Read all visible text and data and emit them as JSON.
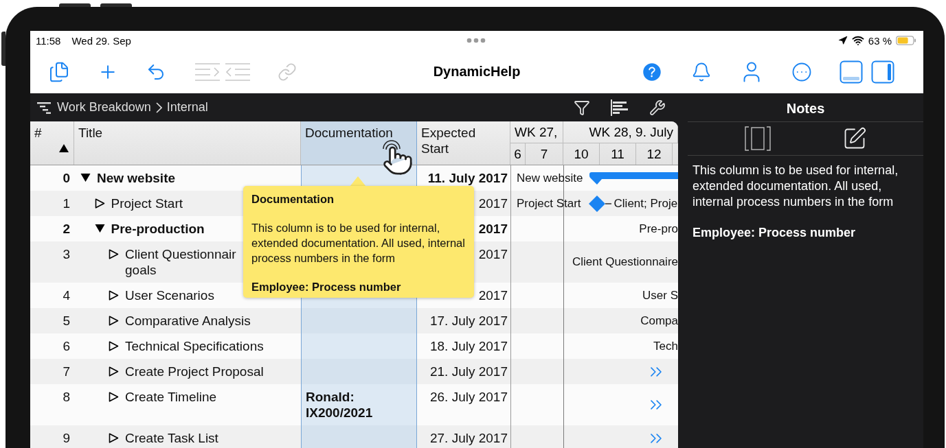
{
  "status_bar": {
    "time": "11:58",
    "date": "Wed 29. Sep",
    "battery": "63 %"
  },
  "toolbar": {
    "left_tools": [
      {
        "kind": "documents",
        "disabled": false
      },
      {
        "kind": "add",
        "disabled": false
      },
      {
        "kind": "undo",
        "disabled": false
      },
      {
        "kind": "indent",
        "disabled": true
      },
      {
        "kind": "outdent",
        "disabled": true
      },
      {
        "kind": "link",
        "disabled": true
      }
    ],
    "title": "DynamicHelp",
    "right_tools": [
      {
        "kind": "help"
      },
      {
        "kind": "notifications"
      },
      {
        "kind": "profile"
      },
      {
        "kind": "more"
      }
    ],
    "panel_toggles": [
      {
        "kind": "bottom",
        "on": false
      },
      {
        "kind": "side",
        "on": true
      }
    ]
  },
  "breadcrumb": [
    "Work Breakdown",
    "Internal"
  ],
  "table": {
    "columns": [
      {
        "label": "#",
        "sorted": true,
        "selected": false
      },
      {
        "label": "Title",
        "sorted": false,
        "selected": false
      },
      {
        "label": "Documentation",
        "sorted": false,
        "selected": true
      },
      {
        "label": "Expected\nStart",
        "sorted": false,
        "selected": false
      }
    ],
    "weeks": [
      "WK 27,",
      "WK 28, 9. July"
    ],
    "days": [
      "6",
      "7",
      "10",
      "11",
      "12"
    ],
    "rows": [
      {
        "number": "0",
        "title": "New website",
        "expanded": true,
        "start": "11. July 2017",
        "gantt": {
          "kind": "bar",
          "label": "New website"
        },
        "children": [
          {
            "number": "1",
            "title": "Project Start",
            "expanded": false,
            "start": "2017",
            "gantt": {
              "kind": "milestone",
              "label": "Project Start",
              "note": "Client; Proje"
            }
          },
          {
            "number": "2",
            "title": "Pre-production",
            "expanded": true,
            "start": "2017",
            "gantt": {
              "kind": "label",
              "label": "Pre-pro"
            },
            "children": [
              {
                "number": "3",
                "title": "Client Questionnair\ngoals",
                "expanded": false,
                "start": "2017",
                "gantt": {
                  "kind": "label",
                  "label": "Client Questionnaire"
                }
              },
              {
                "number": "4",
                "title": "User Scenarios",
                "expanded": false,
                "start": "2017",
                "gantt": {
                  "kind": "label",
                  "label": "User S"
                }
              },
              {
                "number": "5",
                "title": "Comparative Analysis",
                "expanded": false,
                "start": "17. July 2017",
                "gantt": {
                  "kind": "label",
                  "label": "Compa"
                }
              },
              {
                "number": "6",
                "title": "Technical Specifications",
                "expanded": false,
                "start": "18. July 2017",
                "gantt": {
                  "kind": "label",
                  "label": "Tech"
                }
              },
              {
                "number": "7",
                "title": "Create Project Proposal",
                "expanded": false,
                "start": "21. July 2017",
                "gantt": {
                  "kind": "overflow"
                }
              },
              {
                "number": "8",
                "title": "Create Timeline",
                "expanded": false,
                "documentation": "Ronald: IX200/2021",
                "start": "26. July 2017",
                "gantt": {
                  "kind": "overflow"
                }
              },
              {
                "number": "9",
                "title": "Create Task List",
                "expanded": false,
                "start": "27. July 2017",
                "gantt": {
                  "kind": "overflow"
                }
              }
            ]
          }
        ]
      }
    ]
  },
  "tooltip": {
    "title": "Documentation",
    "text": "This column is to be used for internal, extended documentation. All used, internal process numbers in the form",
    "footer": "Employee: Process number"
  },
  "notes": {
    "title": "Notes",
    "text": "This column is to be used for internal, extended documentation. All used, internal process numbers in the form",
    "footer": "Employee: Process number"
  }
}
